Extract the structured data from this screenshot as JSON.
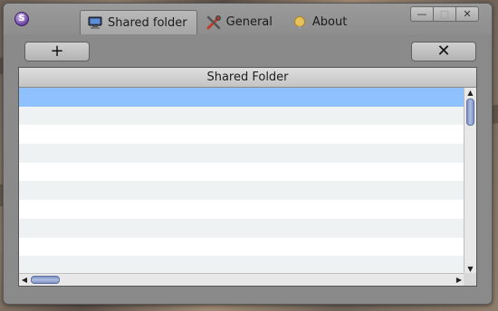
{
  "titlebar": {
    "app_icon_glyph": "S",
    "tabs": [
      {
        "label": "Shared folder",
        "icon": "computer-icon",
        "active": true
      },
      {
        "label": "General",
        "icon": "tools-icon",
        "active": false
      },
      {
        "label": "About",
        "icon": "info-bulb-icon",
        "active": false
      }
    ],
    "controls": {
      "minimize_glyph": "—",
      "maximize_glyph": "□",
      "close_glyph": "✕"
    }
  },
  "toolbar": {
    "add_label": "+",
    "remove_label": "✕"
  },
  "table": {
    "column_header": "Shared Folder",
    "rows": [
      "",
      "",
      "",
      "",
      "",
      "",
      "",
      "",
      "",
      ""
    ],
    "selected_row": 0
  },
  "scrollbars": {
    "up": "▲",
    "down": "▼",
    "left": "◀",
    "right": "▶"
  },
  "colors": {
    "selection": "#8fc1ff",
    "alt_row": "#eef2f2",
    "window_bg": "#8a8a8a"
  }
}
